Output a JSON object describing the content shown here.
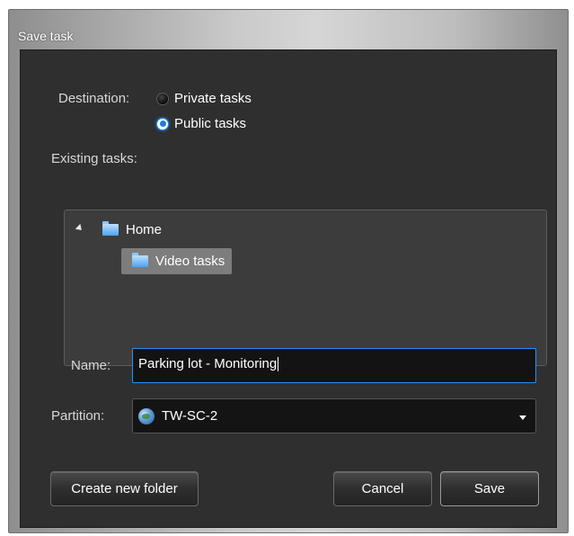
{
  "window": {
    "title": "Save task"
  },
  "destination": {
    "label": "Destination:",
    "options": [
      {
        "label": "Private tasks",
        "checked": false
      },
      {
        "label": "Public tasks",
        "checked": true
      }
    ]
  },
  "existing_tasks": {
    "label": "Existing tasks:",
    "tree": [
      {
        "label": "Home",
        "expanded": true,
        "icon": "folder-icon",
        "children": [
          {
            "label": "Video tasks",
            "selected": true,
            "icon": "folder-icon"
          }
        ]
      }
    ]
  },
  "name_field": {
    "label": "Name:",
    "value": "Parking lot - Monitoring"
  },
  "partition": {
    "label": "Partition:",
    "value": "TW-SC-2",
    "icon": "globe-icon"
  },
  "buttons": {
    "create_folder": "Create new folder",
    "cancel": "Cancel",
    "save": "Save"
  },
  "colors": {
    "accent": "#1e8ae8",
    "background": "#2f2f2f"
  }
}
